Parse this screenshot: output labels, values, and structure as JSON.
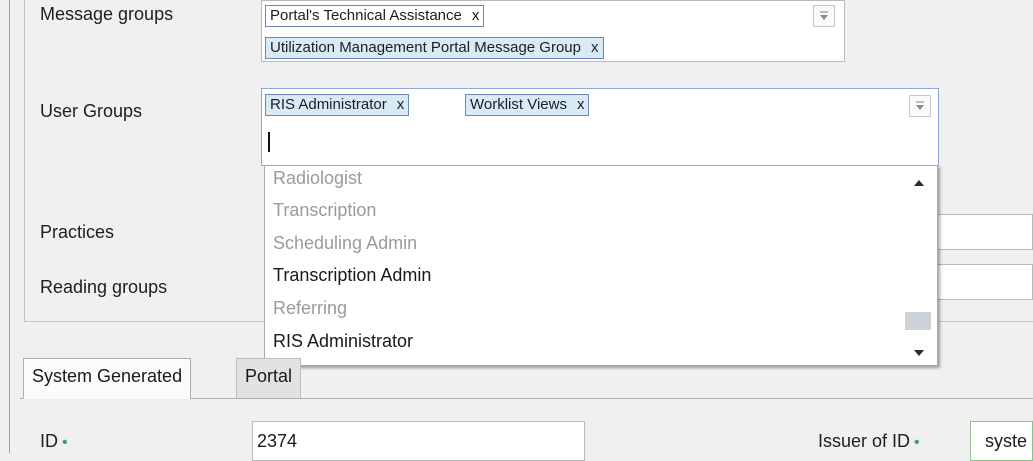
{
  "labels": {
    "message_groups": "Message groups",
    "user_groups": "User Groups",
    "practices": "Practices",
    "reading_groups": "Reading groups",
    "id": "ID",
    "issuer_of_id": "Issuer of ID",
    "required_marker": "•"
  },
  "message_groups": {
    "tags": [
      {
        "label": "Portal's Technical Assistance",
        "remove": "x"
      },
      {
        "label": "Utilization Management Portal Message Group",
        "remove": "x"
      }
    ]
  },
  "user_groups": {
    "tags": [
      {
        "label": "RIS Administrator",
        "remove": "x"
      },
      {
        "label": "Worklist Views",
        "remove": "x"
      }
    ],
    "input_value": "",
    "dropdown_options": [
      {
        "label": "Radiologist",
        "disabled": true
      },
      {
        "label": "Transcription",
        "disabled": true
      },
      {
        "label": "Scheduling Admin",
        "disabled": true
      },
      {
        "label": "Transcription Admin",
        "disabled": false
      },
      {
        "label": "Referring",
        "disabled": true
      },
      {
        "label": "RIS Administrator",
        "disabled": false
      }
    ]
  },
  "tabs": [
    {
      "label": "System Generated",
      "active": true
    },
    {
      "label": "Portal",
      "active": false
    }
  ],
  "fields": {
    "id_value": "2374",
    "issuer_value": "syste"
  },
  "colors": {
    "tag_selected_bg": "#d9eaf7",
    "required_green": "#38a169",
    "focus_border": "#8fa9e0",
    "disabled_text": "#9a9a9a"
  },
  "icons": {
    "dropdown": "chevron-down-icon",
    "scroll_up": "triangle-up-icon",
    "scroll_down": "triangle-down-icon"
  }
}
